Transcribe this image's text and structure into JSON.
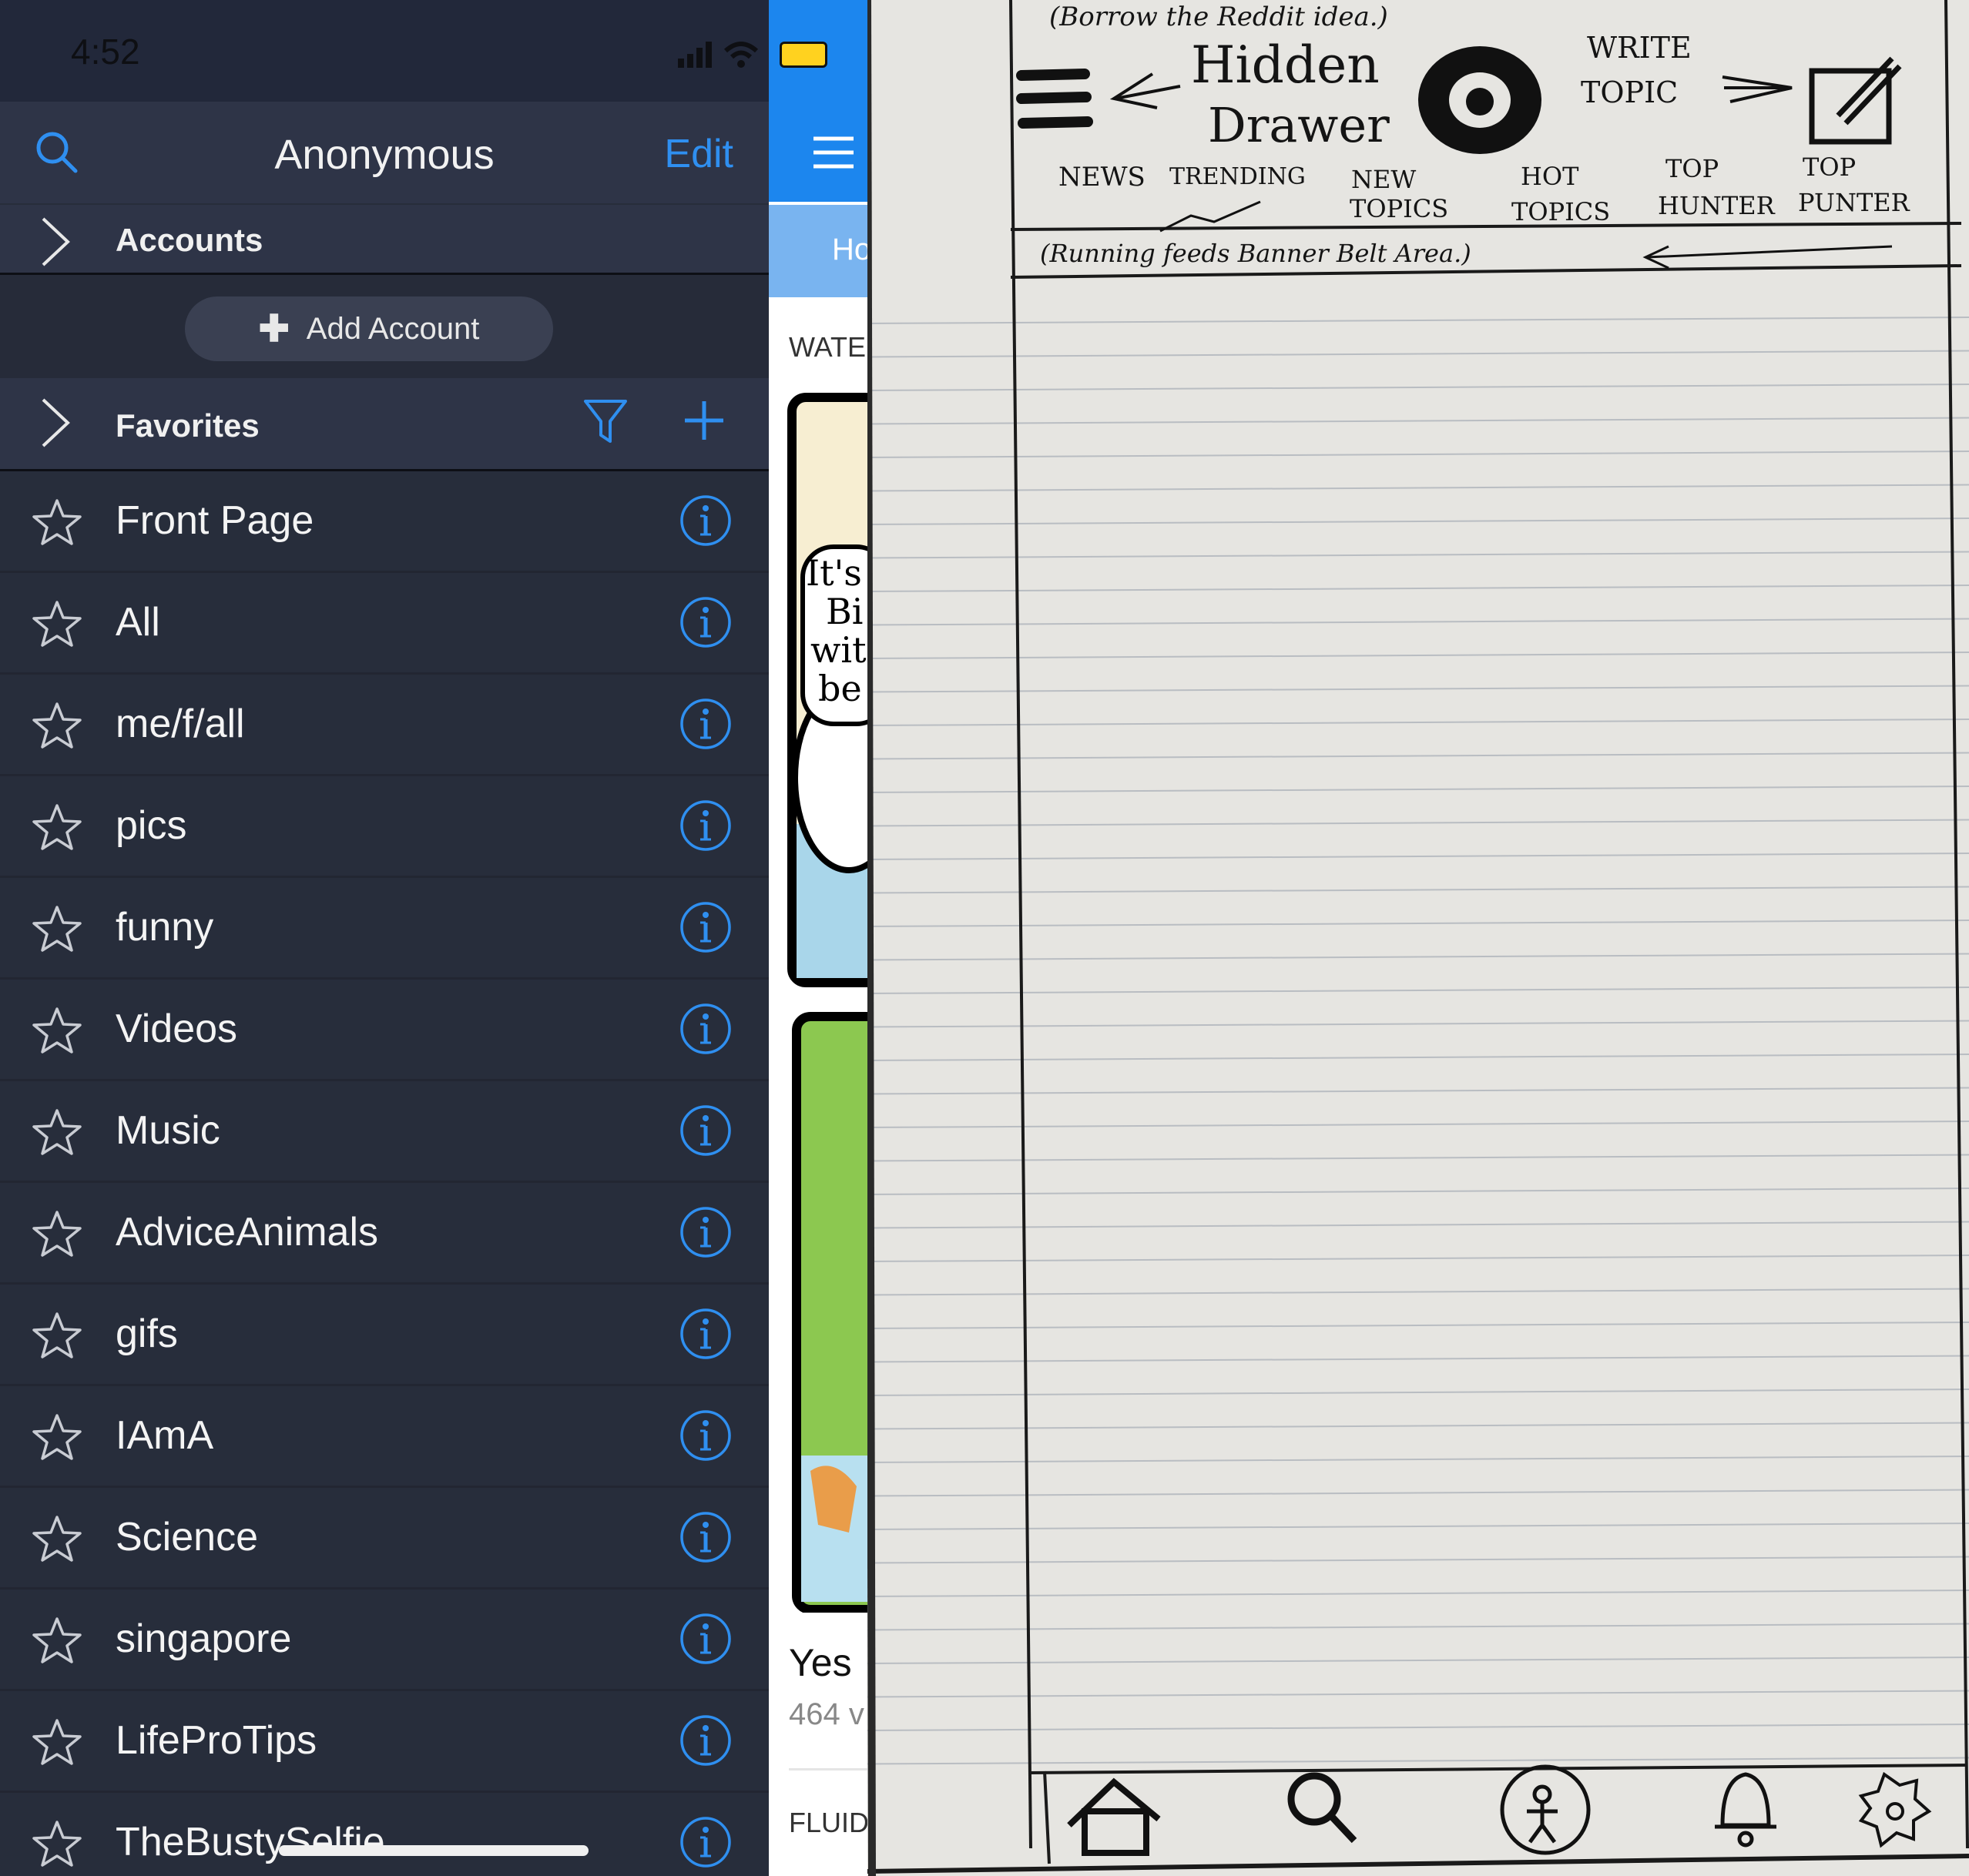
{
  "status": {
    "time": "4:52"
  },
  "nav": {
    "title": "Anonymous",
    "edit_label": "Edit"
  },
  "accounts": {
    "label": "Accounts",
    "add_label": "Add Account"
  },
  "favorites": {
    "label": "Favorites",
    "items": [
      {
        "label": "Front Page"
      },
      {
        "label": "All"
      },
      {
        "label": "me/f/all"
      },
      {
        "label": "pics"
      },
      {
        "label": "funny"
      },
      {
        "label": "Videos"
      },
      {
        "label": "Music"
      },
      {
        "label": "AdviceAnimals"
      },
      {
        "label": "gifs"
      },
      {
        "label": "IAmA"
      },
      {
        "label": "Science"
      },
      {
        "label": "singapore"
      },
      {
        "label": "LifeProTips"
      },
      {
        "label": "TheBustySelfie"
      }
    ]
  },
  "strip": {
    "tab_label": "Ho",
    "section_label": "WATEI",
    "comic_lines": [
      "It's",
      "Bi",
      "wit",
      "be"
    ],
    "post_title": "Yes",
    "post_meta": "464 v",
    "next_section": "FLUID"
  },
  "sketch": {
    "note_top": "(Borrow the Reddit idea.)",
    "drawer_label_1": "Hidden",
    "drawer_label_2": "Drawer",
    "write_label_1": "WRITE",
    "write_label_2": "TOPIC",
    "tabs": [
      {
        "line1": "NEWS",
        "line2": ""
      },
      {
        "line1": "TRENDING",
        "line2": ""
      },
      {
        "line1": "NEW",
        "line2": "TOPICS"
      },
      {
        "line1": "HOT",
        "line2": "TOPICS"
      },
      {
        "line1": "TOP",
        "line2": "HUNTER"
      },
      {
        "line1": "TOP",
        "line2": "PUNTER"
      }
    ],
    "banner_note": "(Running feeds Banner Belt Area.)"
  },
  "colors": {
    "drawer_bg": "#272d3b",
    "accent": "#2f8ff0",
    "app_blue": "#1c86ee",
    "paper": "#e6e5e1"
  },
  "icons": {
    "drawer": [
      "search-icon",
      "chevron-right-icon",
      "plus-icon",
      "filter-icon",
      "star-icon",
      "info-icon"
    ],
    "sketch_bottom": [
      "home-icon",
      "search-icon",
      "profile-icon",
      "bell-icon",
      "gear-icon"
    ]
  }
}
